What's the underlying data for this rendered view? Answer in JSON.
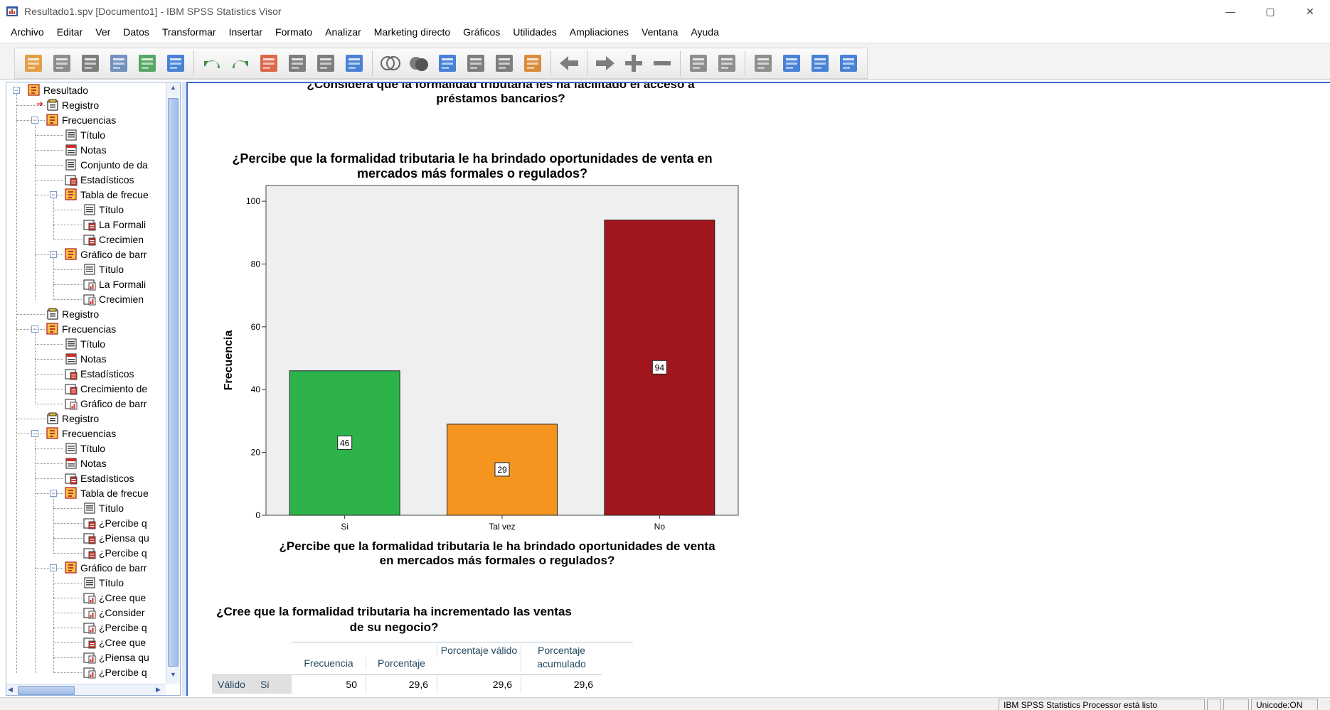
{
  "window": {
    "title": "Resultado1.spv [Documento1] - IBM SPSS Statistics Visor",
    "controls": [
      "—",
      "▢",
      "✕"
    ]
  },
  "menu": [
    {
      "label": "Archivo"
    },
    {
      "label": "Editar"
    },
    {
      "label": "Ver"
    },
    {
      "label": "Datos"
    },
    {
      "label": "Transformar"
    },
    {
      "label": "Insertar"
    },
    {
      "label": "Formato"
    },
    {
      "label": "Analizar"
    },
    {
      "label": "Marketing directo"
    },
    {
      "label": "Gráficos"
    },
    {
      "label": "Utilidades"
    },
    {
      "label": "Ampliaciones"
    },
    {
      "label": "Ventana"
    },
    {
      "label": "Ayuda"
    }
  ],
  "toolbar": {
    "icons": [
      "open-icon",
      "save-icon",
      "print-icon",
      "print-preview-icon",
      "export-icon",
      "recall-dialog-icon",
      "undo-icon",
      "redo-icon",
      "goto-data-icon",
      "goto-case-icon",
      "goto-variable-icon",
      "variables-icon",
      "venn-icon",
      "split-icon",
      "weight-icon",
      "select-cases-icon",
      "value-labels-icon",
      "use-sets-icon",
      "promote-icon",
      "demote-icon",
      "expand-icon",
      "collapse-icon",
      "show-icon",
      "hide-icon",
      "designate-window-icon",
      "insert-heading-icon",
      "insert-title-icon",
      "insert-text-icon"
    ]
  },
  "nav": {
    "items": [
      {
        "label": "Resultado",
        "icon": "output-book-icon"
      },
      {
        "label": "Registro",
        "icon": "log-icon"
      },
      {
        "label": "Frecuencias",
        "icon": "output-book-icon"
      },
      {
        "label": "Título",
        "icon": "title-icon"
      },
      {
        "label": "Notas",
        "icon": "notes-icon"
      },
      {
        "label": "Conjunto de da",
        "icon": "dataset-icon"
      },
      {
        "label": "Estadísticos",
        "icon": "table-icon"
      },
      {
        "label": "Tabla de frecue",
        "icon": "output-book-icon"
      },
      {
        "label": "Título",
        "icon": "title-icon"
      },
      {
        "label": "La Formali",
        "icon": "table-icon"
      },
      {
        "label": "Crecimien",
        "icon": "table-icon"
      },
      {
        "label": "Gráfico de barr",
        "icon": "output-book-icon"
      },
      {
        "label": "Título",
        "icon": "title-icon"
      },
      {
        "label": "La Formali",
        "icon": "chart-icon"
      },
      {
        "label": "Crecimien",
        "icon": "chart-icon"
      },
      {
        "label": "Registro",
        "icon": "log-icon"
      },
      {
        "label": "Frecuencias",
        "icon": "output-book-icon"
      },
      {
        "label": "Título",
        "icon": "title-icon"
      },
      {
        "label": "Notas",
        "icon": "notes-icon"
      },
      {
        "label": "Estadísticos",
        "icon": "table-icon"
      },
      {
        "label": "Crecimiento de",
        "icon": "table-icon"
      },
      {
        "label": "Gráfico de barr",
        "icon": "chart-icon"
      },
      {
        "label": "Registro",
        "icon": "log-icon"
      },
      {
        "label": "Frecuencias",
        "icon": "output-book-icon"
      },
      {
        "label": "Título",
        "icon": "title-icon"
      },
      {
        "label": "Notas",
        "icon": "notes-icon"
      },
      {
        "label": "Estadísticos",
        "icon": "table-icon"
      },
      {
        "label": "Tabla de frecue",
        "icon": "output-book-icon"
      },
      {
        "label": "Título",
        "icon": "title-icon"
      },
      {
        "label": "¿Percibe q",
        "icon": "table-icon"
      },
      {
        "label": "¿Piensa qu",
        "icon": "table-icon"
      },
      {
        "label": "¿Percibe q",
        "icon": "table-icon"
      },
      {
        "label": "Gráfico de barr",
        "icon": "output-book-icon"
      },
      {
        "label": "Título",
        "icon": "title-icon"
      },
      {
        "label": "¿Cree que",
        "icon": "chart-icon"
      },
      {
        "label": "¿Consider",
        "icon": "chart-icon"
      },
      {
        "label": "¿Percibe q",
        "icon": "chart-icon"
      },
      {
        "label": "¿Cree que",
        "icon": "table-icon"
      },
      {
        "label": "¿Piensa qu",
        "icon": "chart-icon"
      },
      {
        "label": "¿Percibe q",
        "icon": "chart-icon"
      }
    ]
  },
  "content": {
    "prev_chart_title_line1": "¿Considera que la formalidad tributaria les ha facilitado el acceso a",
    "prev_chart_title_line2": "préstamos bancarios?",
    "table_title_line1": "¿Cree que la formalidad tributaria ha incrementado las ventas",
    "table_title_line2": "de su negocio?",
    "table": {
      "headers": [
        "Frecuencia",
        "Porcentaje",
        "Porcentaje válido",
        "Porcentaje acumulado"
      ],
      "rows": [
        {
          "group": "Válido",
          "label": "Si",
          "values": [
            "50",
            "29,6",
            "29,6",
            "29,6"
          ]
        }
      ]
    }
  },
  "chart_data": {
    "type": "bar",
    "title": "¿Percibe que la formalidad tributaria le ha brindado oportunidades de venta en mercados más formales o regulados?",
    "title_line1": "¿Percibe que la formalidad tributaria le ha brindado oportunidades de venta en",
    "title_line2": "mercados más formales o regulados?",
    "xlabel_line1": "¿Percibe que la formalidad tributaria le ha brindado oportunidades de venta",
    "xlabel_line2": "en mercados más formales o regulados?",
    "ylabel": "Frecuencia",
    "categories": [
      "Si",
      "Tal vez",
      "No"
    ],
    "values": [
      46,
      29,
      94
    ],
    "data_labels": [
      "46",
      "29",
      "94"
    ],
    "colors": [
      "#2db34a",
      "#f5951f",
      "#a0161c"
    ],
    "ylim": [
      0,
      105
    ],
    "yticks": [
      0,
      20,
      40,
      60,
      80,
      100
    ],
    "plot_background": "#efefef",
    "grid": false
  },
  "status": {
    "processor": "IBM SPSS Statistics Processor está listo",
    "unicode": "Unicode:ON"
  }
}
